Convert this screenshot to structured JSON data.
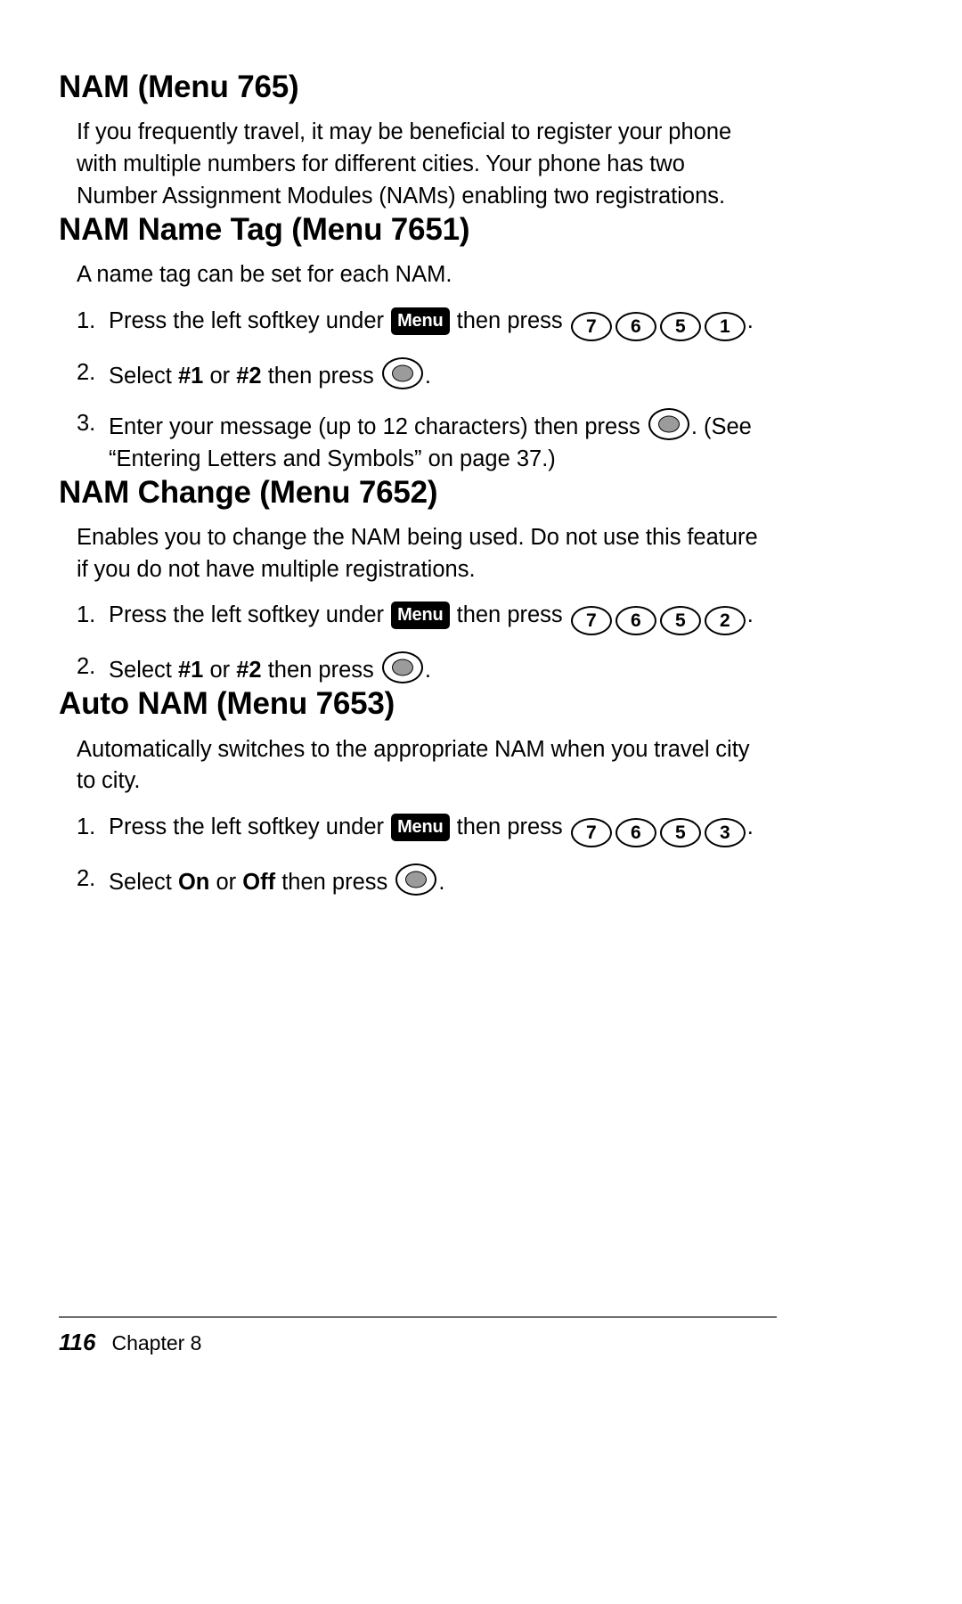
{
  "page": {
    "number": "116",
    "chapter": "Chapter 8"
  },
  "icons": {
    "menu_softkey_label": "Menu",
    "ok_key": "ok-select-key-icon"
  },
  "sections": [
    {
      "heading": "NAM (Menu 765)",
      "intro": "If you frequently travel, it may be beneficial to register your phone with multiple numbers for different cities. Your phone has two Number Assignment Modules (NAMs) enabling two registrations.",
      "steps": []
    },
    {
      "heading": "NAM Name Tag (Menu 7651)",
      "intro": "A name tag can be set for each NAM.",
      "steps": [
        {
          "num": "1.",
          "pre": "Press the left softkey under",
          "badge": "Menu",
          "mid": "then press",
          "keys": [
            "7",
            "6",
            "5",
            "1"
          ],
          "post": "."
        },
        {
          "num": "2.",
          "pre": "Select",
          "bold1": "#1",
          "conj": "or",
          "bold2": "#2",
          "mid": "then press",
          "ok": true,
          "post": "."
        },
        {
          "num": "3.",
          "pre": "Enter your message (up to 12 characters) then press",
          "ok": true,
          "post": ". (See",
          "second_line": "“Entering Letters and Symbols” on page 37.)"
        }
      ]
    },
    {
      "heading": "NAM Change (Menu 7652)",
      "intro": "Enables you to change the NAM being used. Do not use this feature if you do not have multiple registrations.",
      "steps": [
        {
          "num": "1.",
          "pre": "Press the left softkey under",
          "badge": "Menu",
          "mid": "then press",
          "keys": [
            "7",
            "6",
            "5",
            "2"
          ],
          "post": "."
        },
        {
          "num": "2.",
          "pre": "Select",
          "bold1": "#1",
          "conj": "or",
          "bold2": "#2",
          "mid": "then press",
          "ok": true,
          "post": "."
        }
      ]
    },
    {
      "heading": "Auto NAM (Menu 7653)",
      "intro": "Automatically switches to the appropriate NAM when you travel city to city.",
      "steps": [
        {
          "num": "1.",
          "pre": "Press the left softkey under",
          "badge": "Menu",
          "mid": "then press",
          "keys": [
            "7",
            "6",
            "5",
            "3"
          ],
          "post": "."
        },
        {
          "num": "2.",
          "pre": "Select",
          "bold1": "On",
          "conj": "or",
          "bold2": "Off",
          "mid": "then press",
          "ok": true,
          "post": "."
        }
      ]
    }
  ]
}
